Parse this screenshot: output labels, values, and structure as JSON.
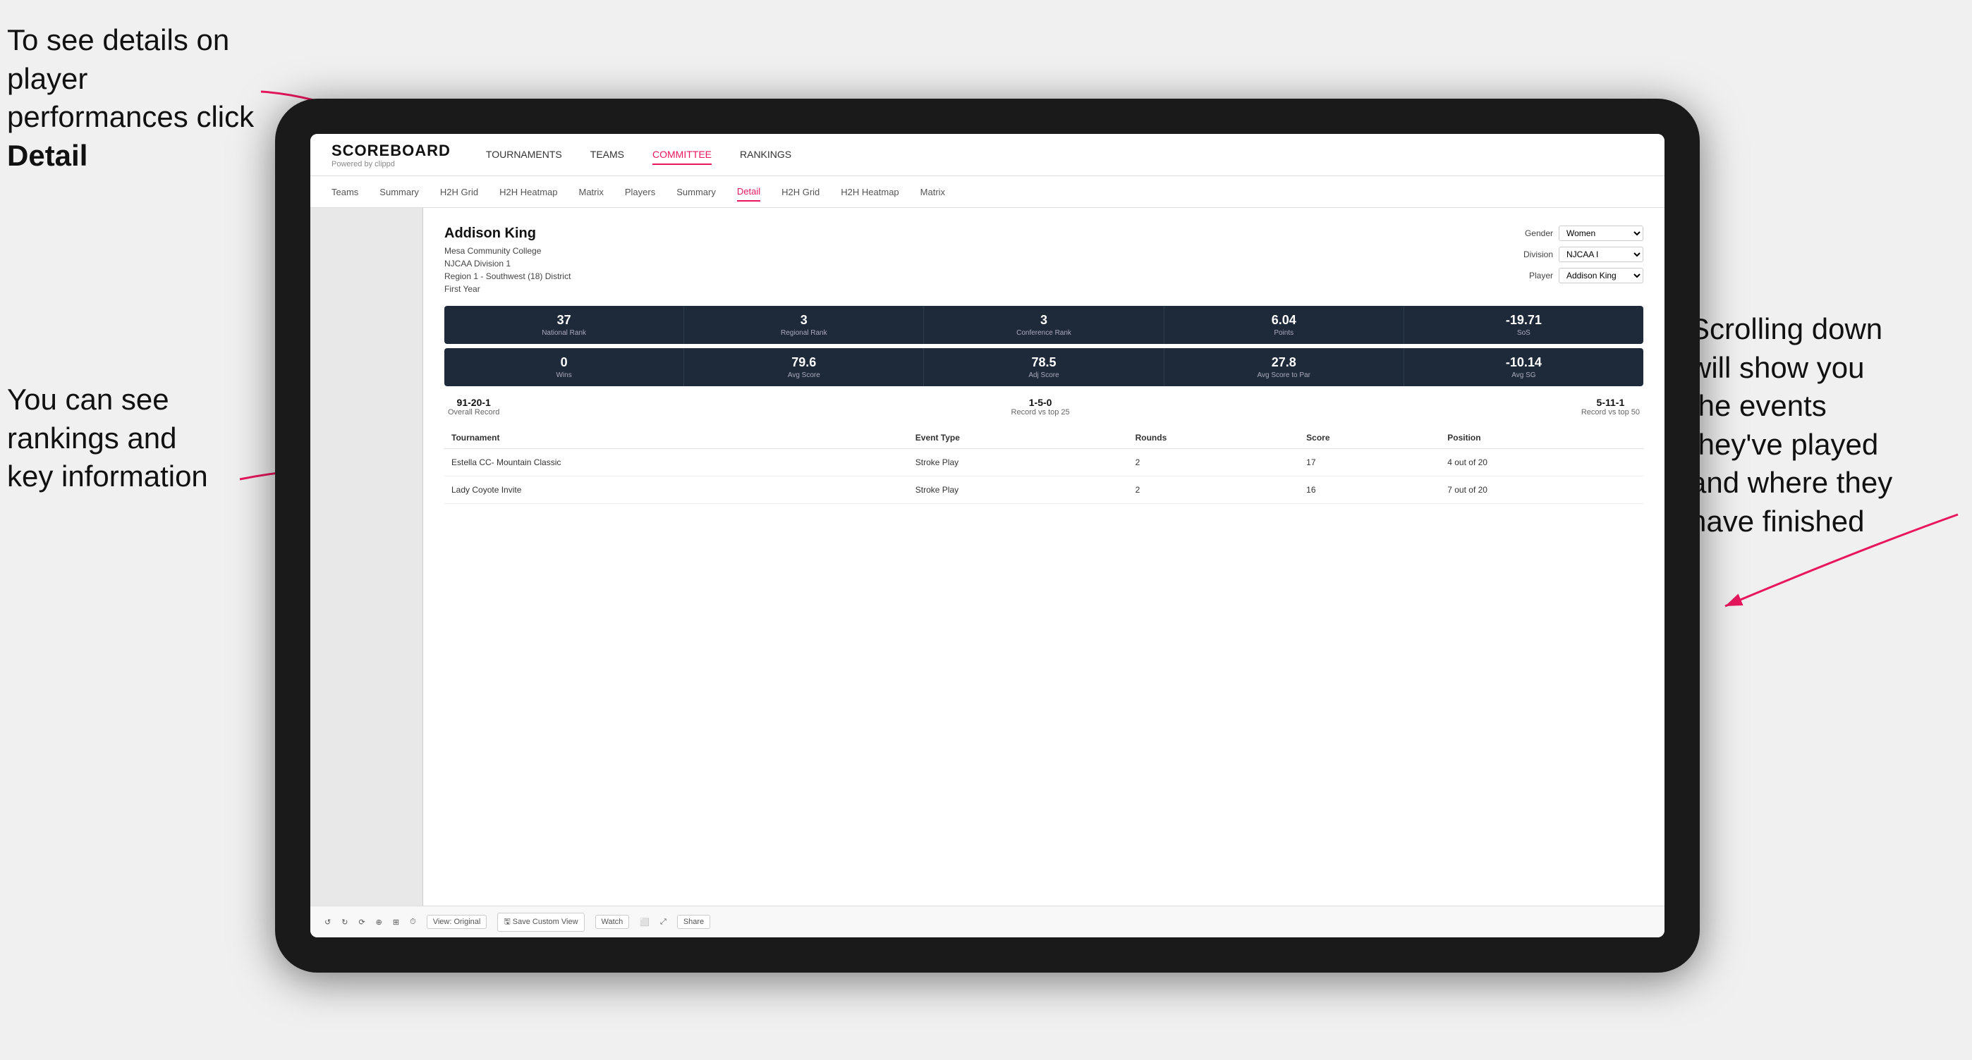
{
  "annotations": {
    "top_left": "To see details on player performances click ",
    "top_left_bold": "Detail",
    "bottom_left_line1": "You can see",
    "bottom_left_line2": "rankings and",
    "bottom_left_line3": "key information",
    "right_line1": "Scrolling down",
    "right_line2": "will show you",
    "right_line3": "the events",
    "right_line4": "they've played",
    "right_line5": "and where they",
    "right_line6": "have finished"
  },
  "app": {
    "logo": "SCOREBOARD",
    "logo_sub": "Powered by clippd",
    "main_nav": [
      "TOURNAMENTS",
      "TEAMS",
      "COMMITTEE",
      "RANKINGS"
    ],
    "active_main_nav": "COMMITTEE",
    "sub_nav": [
      "Teams",
      "Summary",
      "H2H Grid",
      "H2H Heatmap",
      "Matrix",
      "Players",
      "Summary",
      "Detail",
      "H2H Grid",
      "H2H Heatmap",
      "Matrix"
    ],
    "active_sub_nav": "Detail"
  },
  "player": {
    "name": "Addison King",
    "school": "Mesa Community College",
    "division": "NJCAA Division 1",
    "region": "Region 1 - Southwest (18) District",
    "year": "First Year",
    "gender_label": "Gender",
    "gender_value": "Women",
    "division_label": "Division",
    "division_value": "NJCAA I",
    "player_label": "Player",
    "player_value": "Addison King"
  },
  "stats_row1": [
    {
      "value": "37",
      "label": "National Rank"
    },
    {
      "value": "3",
      "label": "Regional Rank"
    },
    {
      "value": "3",
      "label": "Conference Rank"
    },
    {
      "value": "6.04",
      "label": "Points"
    },
    {
      "value": "-19.71",
      "label": "SoS"
    }
  ],
  "stats_row2": [
    {
      "value": "0",
      "label": "Wins"
    },
    {
      "value": "79.6",
      "label": "Avg Score"
    },
    {
      "value": "78.5",
      "label": "Adj Score"
    },
    {
      "value": "27.8",
      "label": "Avg Score to Par"
    },
    {
      "value": "-10.14",
      "label": "Avg SG"
    }
  ],
  "records": [
    {
      "value": "91-20-1",
      "label": "Overall Record"
    },
    {
      "value": "1-5-0",
      "label": "Record vs top 25"
    },
    {
      "value": "5-11-1",
      "label": "Record vs top 50"
    }
  ],
  "table": {
    "headers": [
      "Tournament",
      "Event Type",
      "Rounds",
      "Score",
      "Position"
    ],
    "rows": [
      {
        "tournament": "Estella CC- Mountain Classic",
        "event_type": "Stroke Play",
        "rounds": "2",
        "score": "17",
        "position": "4 out of 20"
      },
      {
        "tournament": "Lady Coyote Invite",
        "event_type": "Stroke Play",
        "rounds": "2",
        "score": "16",
        "position": "7 out of 20"
      }
    ]
  },
  "toolbar": {
    "undo": "↺",
    "redo": "↻",
    "view_original": "View: Original",
    "save_custom": "Save Custom View",
    "watch": "Watch",
    "share": "Share"
  }
}
